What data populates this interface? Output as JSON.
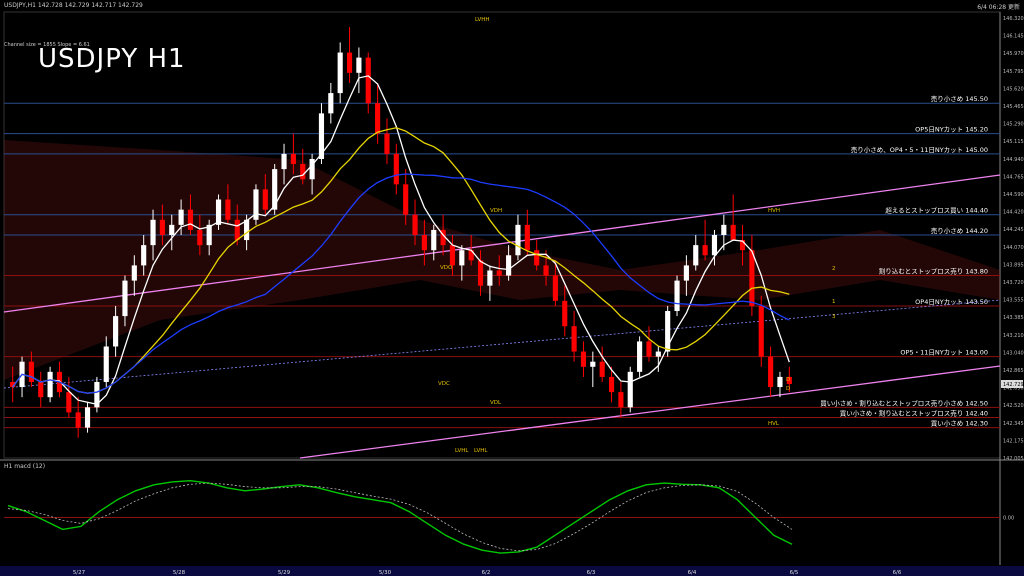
{
  "header": {
    "symbol_info": "USDJPY,H1  142.728 142.729 142.717 142.729",
    "timestamp": "6/4 06:28 更新",
    "channel_info": "Channel size = 1855 Slope = 6.61"
  },
  "chart_title": "USDJPY H1",
  "macd_label": "H1  macd (12)",
  "colors": {
    "background": "#000000",
    "bull_candle": "#ffffff",
    "bear_candle": "#ff0000",
    "level_line": "#2a4d8f",
    "resistance_line": "#8b0000",
    "channel_line": "#ee82ee",
    "sma_white": "#ffffff",
    "sma_yellow": "#e6d400",
    "sma_blue": "#1e3cff",
    "macd_green": "#00c800",
    "macd_pink": "#ff8090",
    "cloud_orange": "#b8860b",
    "cloud_red": "#8b1a1a"
  },
  "chart_data": {
    "type": "candlestick",
    "title": "USDJPY H1",
    "ylim": [
      142.0,
      146.4
    ],
    "y_ticks": [
      "146.320",
      "146.145",
      "145.970",
      "145.795",
      "145.620",
      "145.465",
      "145.290",
      "145.115",
      "144.940",
      "144.765",
      "144.590",
      "144.420",
      "144.245",
      "144.070",
      "143.895",
      "143.720",
      "143.555",
      "143.385",
      "143.210",
      "143.040",
      "142.865",
      "142.690",
      "142.520",
      "142.345",
      "142.175",
      "142.005"
    ],
    "current_price": "142.729",
    "x_ticks": [
      "5/27",
      "5/28",
      "5/29",
      "5/30",
      "6/2",
      "6/3",
      "6/4",
      "6/5",
      "6/6"
    ],
    "levels": [
      {
        "label": "売り小さめ 145.50",
        "price": 145.5
      },
      {
        "label": "OP5日NYカット 145.20",
        "price": 145.2
      },
      {
        "label": "売り小さめ、OP4・5・11日NYカット 145.00",
        "price": 145.0
      },
      {
        "label": "超えるとストップロス買い 144.40",
        "price": 144.4
      },
      {
        "label": "売り小さめ 144.20",
        "price": 144.2
      },
      {
        "label": "割り込むとストップロス売り 143.80",
        "price": 143.8
      },
      {
        "label": "OP4日NYカット 143.50",
        "price": 143.5
      },
      {
        "label": "OP5・11日NYカット 143.00",
        "price": 143.0
      },
      {
        "label": "買い小さめ・割り込むとストップロス売り小さめ 142.50",
        "price": 142.5
      },
      {
        "label": "買い小さめ・割り込むとストップロス売り 142.40",
        "price": 142.4
      },
      {
        "label": "買い小さめ 142.30",
        "price": 142.3
      }
    ],
    "markers": [
      "LVHH",
      "VDH",
      "VDO",
      "VDC",
      "VDL",
      "LVHL",
      "LVHL",
      "HVH",
      "HVL",
      "D",
      "D",
      "1",
      "2",
      "3"
    ],
    "ohlc": [
      [
        142.75,
        142.9,
        142.55,
        142.7
      ],
      [
        142.7,
        143.0,
        142.6,
        142.95
      ],
      [
        142.95,
        143.05,
        142.7,
        142.75
      ],
      [
        142.75,
        142.85,
        142.5,
        142.6
      ],
      [
        142.6,
        142.9,
        142.55,
        142.85
      ],
      [
        142.85,
        142.95,
        142.6,
        142.65
      ],
      [
        142.65,
        142.8,
        142.4,
        142.45
      ],
      [
        142.45,
        142.6,
        142.2,
        142.3
      ],
      [
        142.3,
        142.55,
        142.25,
        142.5
      ],
      [
        142.5,
        142.8,
        142.45,
        142.75
      ],
      [
        142.75,
        143.2,
        142.7,
        143.1
      ],
      [
        143.1,
        143.5,
        143.0,
        143.4
      ],
      [
        143.4,
        143.8,
        143.3,
        143.75
      ],
      [
        143.75,
        144.0,
        143.6,
        143.9
      ],
      [
        143.9,
        144.2,
        143.8,
        144.1
      ],
      [
        144.1,
        144.45,
        143.95,
        144.35
      ],
      [
        144.35,
        144.5,
        144.1,
        144.2
      ],
      [
        144.2,
        144.4,
        144.05,
        144.3
      ],
      [
        144.3,
        144.55,
        144.2,
        144.45
      ],
      [
        144.45,
        144.6,
        144.2,
        144.25
      ],
      [
        144.25,
        144.4,
        144.0,
        144.1
      ],
      [
        144.1,
        144.35,
        144.0,
        144.3
      ],
      [
        144.3,
        144.6,
        144.25,
        144.55
      ],
      [
        144.55,
        144.7,
        144.3,
        144.35
      ],
      [
        144.35,
        144.5,
        144.1,
        144.15
      ],
      [
        144.15,
        144.4,
        144.05,
        144.35
      ],
      [
        144.35,
        144.7,
        144.3,
        144.65
      ],
      [
        144.65,
        144.8,
        144.4,
        144.45
      ],
      [
        144.45,
        144.9,
        144.4,
        144.85
      ],
      [
        144.85,
        145.1,
        144.7,
        145.0
      ],
      [
        145.0,
        145.2,
        144.8,
        144.9
      ],
      [
        144.9,
        145.05,
        144.7,
        144.75
      ],
      [
        144.75,
        145.0,
        144.6,
        144.95
      ],
      [
        144.95,
        145.5,
        144.9,
        145.4
      ],
      [
        145.4,
        145.7,
        145.3,
        145.6
      ],
      [
        145.6,
        146.1,
        145.5,
        146.0
      ],
      [
        146.0,
        146.25,
        145.7,
        145.8
      ],
      [
        145.8,
        146.05,
        145.6,
        145.95
      ],
      [
        145.95,
        146.0,
        145.4,
        145.5
      ],
      [
        145.5,
        145.7,
        145.1,
        145.2
      ],
      [
        145.2,
        145.35,
        144.9,
        145.0
      ],
      [
        145.0,
        145.1,
        144.6,
        144.7
      ],
      [
        144.7,
        144.85,
        144.3,
        144.4
      ],
      [
        144.4,
        144.55,
        144.1,
        144.2
      ],
      [
        144.2,
        144.35,
        143.9,
        144.05
      ],
      [
        144.05,
        144.3,
        143.95,
        144.25
      ],
      [
        144.25,
        144.4,
        144.0,
        144.1
      ],
      [
        144.1,
        144.2,
        143.8,
        143.9
      ],
      [
        143.9,
        144.1,
        143.75,
        144.05
      ],
      [
        144.05,
        144.2,
        143.9,
        143.95
      ],
      [
        143.95,
        144.05,
        143.6,
        143.7
      ],
      [
        143.7,
        143.9,
        143.55,
        143.85
      ],
      [
        143.85,
        144.0,
        143.7,
        143.8
      ],
      [
        143.8,
        144.1,
        143.75,
        144.0
      ],
      [
        144.0,
        144.4,
        143.95,
        144.3
      ],
      [
        144.3,
        144.45,
        144.0,
        144.05
      ],
      [
        144.05,
        144.15,
        143.85,
        143.9
      ],
      [
        143.9,
        144.05,
        143.7,
        143.8
      ],
      [
        143.8,
        143.95,
        143.5,
        143.55
      ],
      [
        143.55,
        143.7,
        143.2,
        143.3
      ],
      [
        143.3,
        143.45,
        142.95,
        143.05
      ],
      [
        143.05,
        143.15,
        142.8,
        142.9
      ],
      [
        142.9,
        143.05,
        142.7,
        142.95
      ],
      [
        142.95,
        143.1,
        142.75,
        142.8
      ],
      [
        142.8,
        142.9,
        142.55,
        142.65
      ],
      [
        142.65,
        142.75,
        142.4,
        142.5
      ],
      [
        142.5,
        142.9,
        142.45,
        142.85
      ],
      [
        142.85,
        143.2,
        142.8,
        143.15
      ],
      [
        143.15,
        143.3,
        142.95,
        143.0
      ],
      [
        143.0,
        143.1,
        142.85,
        143.05
      ],
      [
        143.05,
        143.5,
        143.0,
        143.45
      ],
      [
        143.45,
        143.8,
        143.4,
        143.75
      ],
      [
        143.75,
        144.0,
        143.6,
        143.9
      ],
      [
        143.9,
        144.2,
        143.85,
        144.1
      ],
      [
        144.1,
        144.35,
        143.95,
        144.0
      ],
      [
        144.0,
        144.25,
        143.9,
        144.2
      ],
      [
        144.2,
        144.4,
        144.05,
        144.3
      ],
      [
        144.3,
        144.6,
        144.25,
        144.15
      ],
      [
        144.15,
        144.3,
        143.9,
        144.05
      ],
      [
        144.05,
        144.2,
        143.4,
        143.5
      ],
      [
        143.5,
        143.6,
        142.9,
        143.0
      ],
      [
        143.0,
        143.1,
        142.6,
        142.7
      ],
      [
        142.7,
        142.85,
        142.6,
        142.8
      ],
      [
        142.8,
        142.9,
        142.65,
        142.73
      ]
    ],
    "macd_line": [
      0.2,
      0.1,
      -0.05,
      -0.2,
      -0.15,
      0.1,
      0.3,
      0.45,
      0.55,
      0.6,
      0.62,
      0.58,
      0.5,
      0.45,
      0.48,
      0.52,
      0.55,
      0.5,
      0.42,
      0.35,
      0.3,
      0.25,
      0.1,
      -0.1,
      -0.3,
      -0.45,
      -0.55,
      -0.6,
      -0.58,
      -0.5,
      -0.3,
      -0.1,
      0.1,
      0.3,
      0.45,
      0.55,
      0.58,
      0.56,
      0.55,
      0.5,
      0.3,
      0.0,
      -0.3,
      -0.45
    ],
    "signal_line": [
      0.15,
      0.12,
      0.05,
      -0.05,
      -0.1,
      -0.02,
      0.12,
      0.28,
      0.4,
      0.5,
      0.56,
      0.58,
      0.56,
      0.52,
      0.5,
      0.5,
      0.52,
      0.52,
      0.48,
      0.42,
      0.36,
      0.31,
      0.22,
      0.08,
      -0.1,
      -0.28,
      -0.42,
      -0.52,
      -0.56,
      -0.54,
      -0.44,
      -0.28,
      -0.1,
      0.1,
      0.28,
      0.42,
      0.5,
      0.54,
      0.55,
      0.53,
      0.44,
      0.24,
      0.0,
      -0.2
    ],
    "macd_zero": "0.00"
  }
}
